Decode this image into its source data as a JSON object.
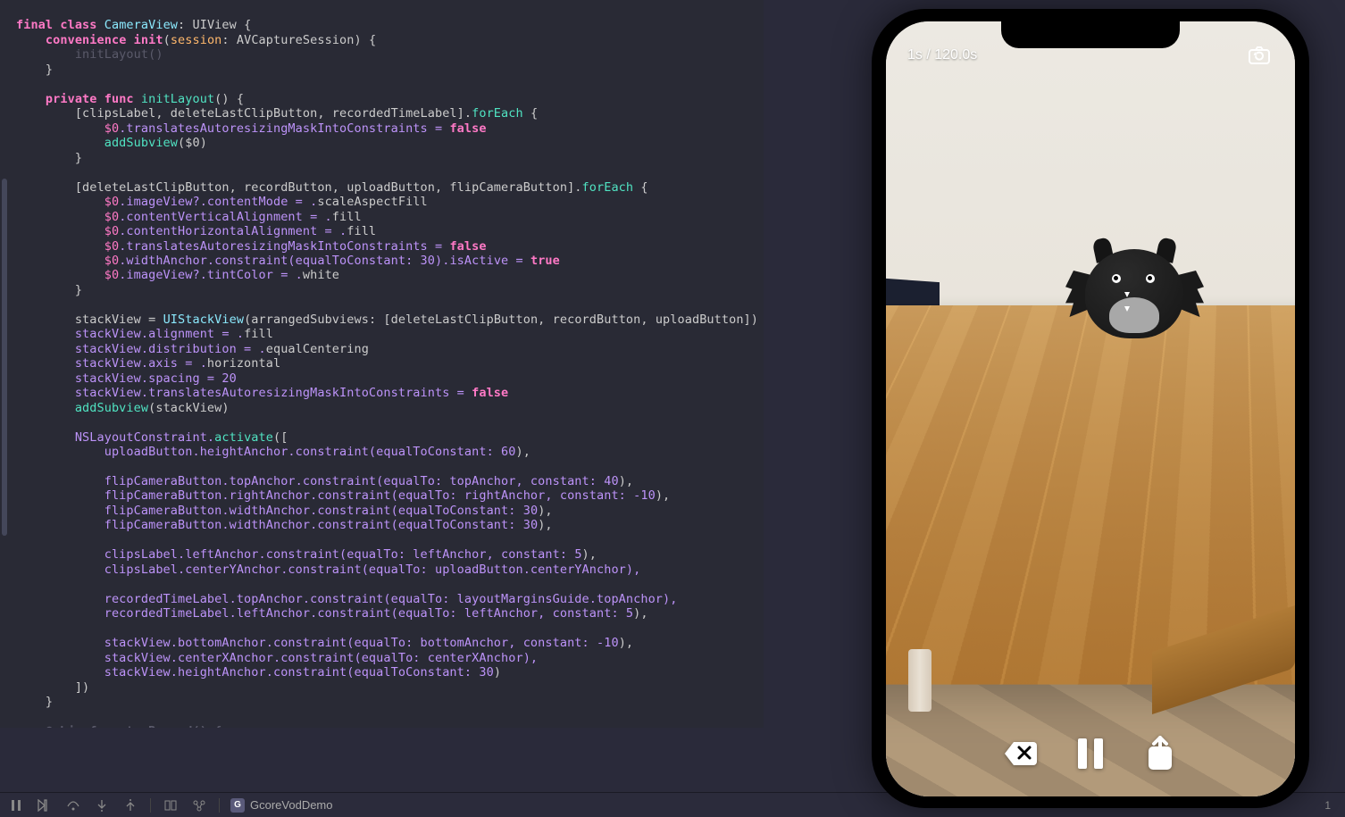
{
  "bottomBar": {
    "projectName": "GcoreVodDemo",
    "lineCol": "1"
  },
  "phone": {
    "recordedTime": "1s / 120.0s"
  },
  "code": {
    "l1a": "final class",
    "l1b": "CameraView",
    "l1c": ": UIView {",
    "l2a": "convenience init",
    "l2b": "(",
    "l2c": "session",
    "l2d": ": AVCaptureSession) {",
    "l3": "        initLayout()",
    "l4": "    }",
    "blank": "",
    "l6a": "private func",
    "l6b": "initLayout",
    "l6c": "() {",
    "l7a": "        [clipsLabel, deleteLastClipButton, recordedTimeLabel].",
    "l7b": "forEach",
    "l7c": " {",
    "l8a": "            $0",
    "l8b": ".translatesAutoresizingMaskIntoConstraints = ",
    "l8c": "false",
    "l9a": "            addSubview",
    "l9b": "($0)",
    "l10": "        }",
    "l12a": "        [deleteLastClipButton, recordButton, uploadButton, flipCameraButton].",
    "l12b": "forEach",
    "l12c": " {",
    "l13a": "            $0",
    "l13b": ".imageView?.contentMode = .",
    "l13c": "scaleAspectFill",
    "l14a": "            $0",
    "l14b": ".contentVerticalAlignment = .",
    "l14c": "fill",
    "l15a": "            $0",
    "l15b": ".contentHorizontalAlignment = .",
    "l15c": "fill",
    "l16a": "            $0",
    "l16b": ".translatesAutoresizingMaskIntoConstraints = ",
    "l16c": "false",
    "l17a": "            $0",
    "l17b": ".widthAnchor.constraint(equalToConstant: ",
    "l17c": "30",
    "l17d": ").isActive = ",
    "l17e": "true",
    "l18a": "            $0",
    "l18b": ".imageView?.tintColor = .",
    "l18c": "white",
    "l19": "        }",
    "l21a": "        stackView = ",
    "l21b": "UIStackView",
    "l21c": "(arrangedSubviews: [deleteLastClipButton, recordButton, uploadButton])",
    "l22a": "        stackView.alignment = .",
    "l22b": "fill",
    "l23a": "        stackView.distribution = .",
    "l23b": "equalCentering",
    "l24a": "        stackView.axis = .",
    "l24b": "horizontal",
    "l25a": "        stackView.spacing = ",
    "l25b": "20",
    "l26a": "        stackView.translatesAutoresizingMaskIntoConstraints = ",
    "l26b": "false",
    "l27a": "        addSubview",
    "l27b": "(stackView)",
    "l29a": "        NSLayoutConstraint.",
    "l29b": "activate",
    "l29c": "([",
    "l30a": "            uploadButton.heightAnchor.constraint(equalToConstant: ",
    "l30b": "60",
    "l30c": "),",
    "l32a": "            flipCameraButton.topAnchor.constraint(equalTo: topAnchor, constant: ",
    "l32b": "40",
    "l32c": "),",
    "l33a": "            flipCameraButton.rightAnchor.constraint(equalTo: rightAnchor, constant: ",
    "l33b": "-10",
    "l33c": "),",
    "l34a": "            flipCameraButton.widthAnchor.constraint(equalToConstant: ",
    "l34b": "30",
    "l34c": "),",
    "l35a": "            flipCameraButton.widthAnchor.constraint(equalToConstant: ",
    "l35b": "30",
    "l35c": "),",
    "l37a": "            clipsLabel.leftAnchor.constraint(equalTo: leftAnchor, constant: ",
    "l37b": "5",
    "l37c": "),",
    "l38a": "            clipsLabel.centerYAnchor.constraint(equalTo: uploadButton.centerYAnchor),",
    "l40a": "            recordedTimeLabel.topAnchor.constraint(equalTo: layoutMarginsGuide.topAnchor),",
    "l41a": "            recordedTimeLabel.leftAnchor.constraint(equalTo: leftAnchor, constant: ",
    "l41b": "5",
    "l41c": "),",
    "l43a": "            stackView.bottomAnchor.constraint(equalTo: bottomAnchor, constant: ",
    "l43b": "-10",
    "l43c": "),",
    "l44a": "            stackView.centerXAnchor.constraint(equalTo: centerXAnchor),",
    "l45a": "            stackView.heightAnchor.constraint(equalToConstant: ",
    "l45b": "30",
    "l45c": ")",
    "l46": "        ])",
    "l47": "    }",
    "l49": "    @objc func tapRecord() {"
  }
}
